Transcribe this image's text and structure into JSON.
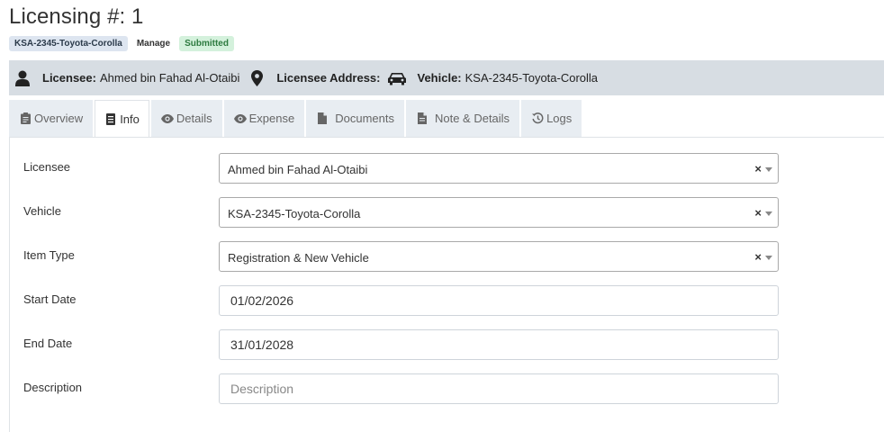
{
  "page": {
    "title": "Licensing #: 1"
  },
  "badges": {
    "plate": "KSA-2345-Toyota-Corolla",
    "manage": "Manage",
    "status": "Submitted"
  },
  "info_bar": {
    "licensee_label": "Licensee:",
    "licensee_value": "Ahmed bin Fahad Al-Otaibi",
    "address_label": "Licensee Address:",
    "address_value": "",
    "vehicle_label": "Vehicle:",
    "vehicle_value": "KSA-2345-Toyota-Corolla",
    "icons": [
      "user-icon",
      "map-marker-icon",
      "car-icon"
    ]
  },
  "tabs": [
    {
      "label": "Overview",
      "icon": "clipboard-icon",
      "active": false
    },
    {
      "label": "Info",
      "icon": "document-icon",
      "active": true
    },
    {
      "label": "Details",
      "icon": "eye-icon",
      "active": false
    },
    {
      "label": "Expense",
      "icon": "eye-icon",
      "active": false
    },
    {
      "label": "Documents",
      "icon": "file-icon",
      "active": false
    },
    {
      "label": "Note & Details",
      "icon": "file-text-icon",
      "active": false
    },
    {
      "label": "Logs",
      "icon": "history-icon",
      "active": false
    }
  ],
  "form": {
    "licensee": {
      "label": "Licensee",
      "value": "Ahmed bin Fahad Al-Otaibi",
      "clear": "×"
    },
    "vehicle": {
      "label": "Vehicle",
      "value": "KSA-2345-Toyota-Corolla",
      "clear": "×"
    },
    "item_type": {
      "label": "Item Type",
      "value": "Registration & New Vehicle",
      "clear": "×"
    },
    "start_date": {
      "label": "Start Date",
      "value": "01/02/2026"
    },
    "end_date": {
      "label": "End Date",
      "value": "31/01/2028"
    },
    "description": {
      "label": "Description",
      "value": "",
      "placeholder": "Description"
    }
  },
  "colors": {
    "info_bar_bg": "#d7dde3",
    "tab_bg": "#e8edf2",
    "badge_plate_bg": "#dde5f0",
    "badge_status_bg": "#d4f1dc",
    "badge_status_text": "#2d7a3f"
  }
}
